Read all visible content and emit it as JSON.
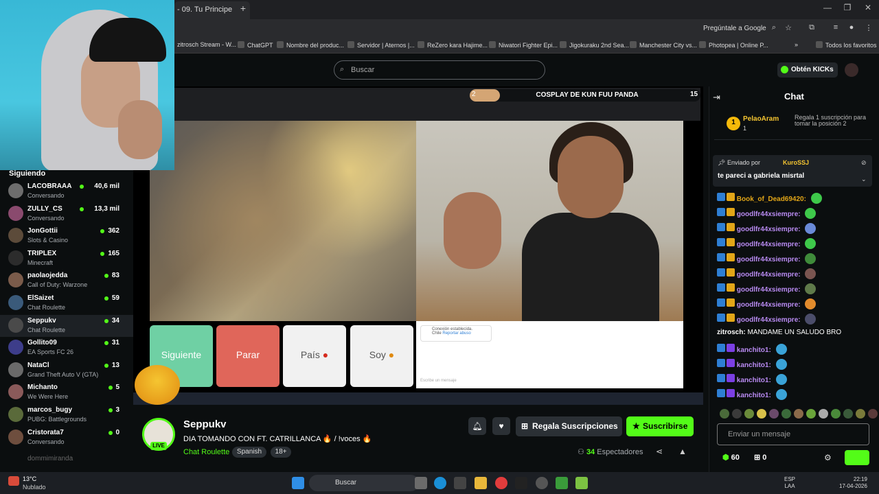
{
  "browser": {
    "active_tab": "- 09. Tu Principe",
    "ask_google": "Pregúntale a Google",
    "bookmarks": [
      "zitrosch Stream - W...",
      "ChatGPT",
      "Nombre del produc...",
      "Servidor | Aternos |...",
      "ReZero kara Hajime...",
      "Niwatori Fighter Epi...",
      "Jigokuraku 2nd Sea...",
      "Manchester City vs...",
      "Photopea | Online P..."
    ],
    "all_bookmarks": "Todos los favoritos"
  },
  "header": {
    "search_placeholder": "Buscar",
    "get_kicks": "Obtén KICKs"
  },
  "sidebar": {
    "title": "Siguiendo",
    "items": [
      {
        "name": "LACOBRAAA",
        "category": "Conversando",
        "viewers": "40,6 mil"
      },
      {
        "name": "ZULLY_CS",
        "category": "Conversando",
        "viewers": "13,3 mil"
      },
      {
        "name": "JonGottii",
        "category": "Slots & Casino",
        "viewers": "362"
      },
      {
        "name": "TRIPLEX",
        "category": "Minecraft",
        "viewers": "165"
      },
      {
        "name": "paolaojedda",
        "category": "Call of Duty: Warzone",
        "viewers": "83"
      },
      {
        "name": "ElSaizet",
        "category": "Chat Roulette",
        "viewers": "59"
      },
      {
        "name": "Seppukv",
        "category": "Chat Roulette",
        "viewers": "34"
      },
      {
        "name": "Gollito09",
        "category": "EA Sports FC 26",
        "viewers": "31"
      },
      {
        "name": "NataCl",
        "category": "Grand Theft Auto V (GTA)",
        "viewers": "13"
      },
      {
        "name": "Michanto",
        "category": "We Were Here",
        "viewers": "5"
      },
      {
        "name": "marcos_bugy",
        "category": "PUBG: Battlegrounds",
        "viewers": "3"
      },
      {
        "name": "Cristorata7",
        "category": "Conversando",
        "viewers": "0"
      }
    ],
    "offline_user": "dommimiranda"
  },
  "player": {
    "vote_left": "2",
    "vote_right": "15",
    "vote_title": "COSPLAY DE KUN FUU PANDA",
    "btn_next": "Siguiente",
    "btn_stop": "Parar",
    "btn_country": "País",
    "btn_iam": "Soy",
    "connection_msg": "Conexión establecida.",
    "connection_country": "Chile",
    "report": "Reportar abuso",
    "inner_input_placeholder": "Escribe un mensaje"
  },
  "stream": {
    "streamer": "Seppukv",
    "live": "LIVE",
    "title": "DIA TOMANDO CON FT. CATRILLANCA 🔥 / !voces 🔥",
    "category": "Chat Roulette",
    "language": "Spanish",
    "age": "18+",
    "gift_subs": "Regala Suscripciones",
    "subscribe": "Suscribirse",
    "viewers_count": "34",
    "viewers_label": "Espectadores"
  },
  "chat": {
    "title": "Chat",
    "pinned_gift": {
      "user": "PelaoAram",
      "count": "1",
      "coin": "1",
      "desc": "Regala 1 suscripción para tomar la posición 2"
    },
    "pinned_msg": {
      "sent_by": "Enviado por",
      "user": "KuroSSJ",
      "text": "te pareci a gabriela misrtal"
    },
    "messages": [
      {
        "user": "Book_of_Dead69420:",
        "text": "",
        "color": "#e2a618",
        "emote": "#3ec84a"
      },
      {
        "user": "goodlfr44xsiempre:",
        "text": "",
        "color": "#b98bf2",
        "emote": "#3ec84a"
      },
      {
        "user": "goodlfr44xsiempre:",
        "text": "",
        "color": "#b98bf2",
        "emote": "#6a8ad8"
      },
      {
        "user": "goodlfr44xsiempre:",
        "text": "",
        "color": "#b98bf2",
        "emote": "#3ec84a"
      },
      {
        "user": "goodlfr44xsiempre:",
        "text": "",
        "color": "#b98bf2",
        "emote": "#3f8b3a"
      },
      {
        "user": "goodlfr44xsiempre:",
        "text": "",
        "color": "#b98bf2",
        "emote": "#7a5550"
      },
      {
        "user": "goodlfr44xsiempre:",
        "text": "",
        "color": "#b98bf2",
        "emote": "#5f7a4a"
      },
      {
        "user": "goodlfr44xsiempre:",
        "text": "",
        "color": "#b98bf2",
        "emote": "#e28b2c"
      },
      {
        "user": "goodlfr44xsiempre:",
        "text": "",
        "color": "#b98bf2",
        "emote": "#4b4d6a"
      },
      {
        "user": "zitrosch:",
        "text": "MANDAME UN SALUDO BRO",
        "color": "#ffffff",
        "emote": ""
      },
      {
        "user": "kanchito1:",
        "text": "",
        "color": "#b98bf2",
        "emote": "#3aa3d8"
      },
      {
        "user": "kanchito1:",
        "text": "",
        "color": "#b98bf2",
        "emote": "#3aa3d8"
      },
      {
        "user": "kanchito1:",
        "text": "",
        "color": "#b98bf2",
        "emote": "#3aa3d8"
      },
      {
        "user": "kanchito1:",
        "text": "",
        "color": "#b98bf2",
        "emote": "#3aa3d8"
      }
    ],
    "input_placeholder": "Enviar un mensaje",
    "kicks": "60",
    "gifts": "0"
  },
  "taskbar": {
    "temp": "13°C",
    "weather": "Nublado",
    "search": "Buscar",
    "lang_top": "ESP",
    "lang_bottom": "LAA",
    "time": "22:19",
    "date": "17-04-2026"
  },
  "colors": {
    "kick_green": "#53fc18",
    "bg": "#0b0e0f"
  }
}
